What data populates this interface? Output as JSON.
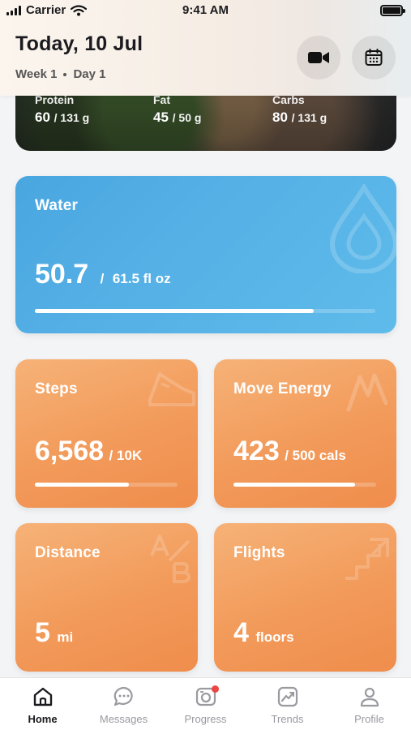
{
  "status_bar": {
    "carrier": "Carrier",
    "time": "9:41 AM"
  },
  "header": {
    "title": "Today, 10 Jul",
    "week": "Week 1",
    "day": "Day 1"
  },
  "macros": [
    {
      "label": "Protein",
      "value": "60",
      "target": "/ 131 g"
    },
    {
      "label": "Fat",
      "value": "45",
      "target": "/ 50 g"
    },
    {
      "label": "Carbs",
      "value": "80",
      "target": "/ 131 g"
    }
  ],
  "water": {
    "title": "Water",
    "value": "50.7",
    "separator": "/",
    "target": "61.5 fl oz",
    "progress": 0.82
  },
  "steps": {
    "title": "Steps",
    "value": "6,568",
    "target": "/ 10K",
    "progress": 0.66
  },
  "move_energy": {
    "title": "Move Energy",
    "value": "423",
    "target": "/ 500 cals",
    "progress": 0.85
  },
  "distance": {
    "title": "Distance",
    "value": "5",
    "unit": "mi"
  },
  "flights": {
    "title": "Flights",
    "value": "4",
    "unit": "floors"
  },
  "tabs": [
    {
      "label": "Home",
      "icon": "home-icon",
      "active": true
    },
    {
      "label": "Messages",
      "icon": "chat-bubble-icon",
      "active": false
    },
    {
      "label": "Progress",
      "icon": "camera-icon",
      "active": false
    },
    {
      "label": "Trends",
      "icon": "trend-chart-icon",
      "active": false
    },
    {
      "label": "Profile",
      "icon": "person-icon",
      "active": false
    }
  ],
  "colors": {
    "water": "#4aa6e0",
    "orange": "#f29a5a",
    "badge": "#ef4444"
  }
}
